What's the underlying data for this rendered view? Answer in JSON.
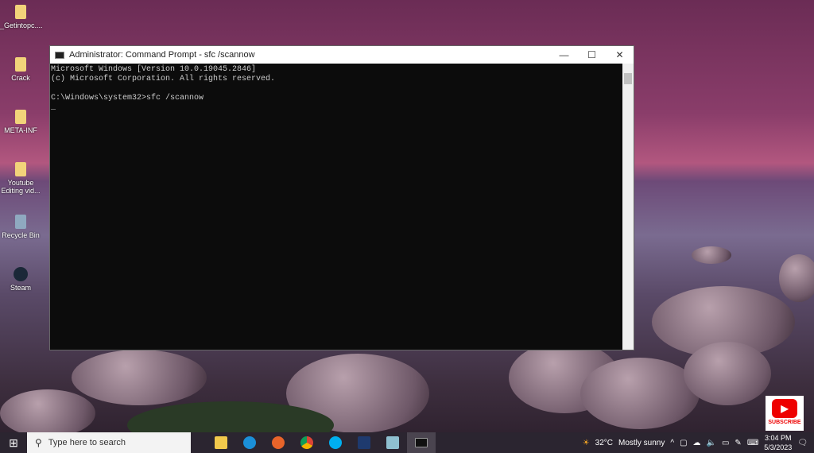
{
  "desktop": {
    "icons": [
      {
        "label": "_Getintopc....",
        "icon": "folder-icon"
      },
      {
        "label": "Crack",
        "icon": "folder-icon"
      },
      {
        "label": "META-INF",
        "icon": "folder-icon"
      },
      {
        "label": "Youtube Editing vid...",
        "icon": "folder-shortcut-icon"
      },
      {
        "label": "Recycle Bin",
        "icon": "recycle-bin-icon"
      },
      {
        "label": "Steam",
        "icon": "steam-icon"
      }
    ]
  },
  "window": {
    "title": "Administrator: Command Prompt - sfc  /scannow",
    "minimize": "—",
    "maximize": "☐",
    "close": "✕",
    "lines": [
      "Microsoft Windows [Version 10.0.19045.2846]",
      "(c) Microsoft Corporation. All rights reserved.",
      "",
      "C:\\Windows\\system32>sfc /scannow",
      "_"
    ]
  },
  "taskbar": {
    "start": "⊞",
    "search_placeholder": "Type here to search",
    "apps": [
      "file-explorer",
      "edge",
      "firefox",
      "chrome",
      "skype",
      "app",
      "app2",
      "command-prompt"
    ],
    "weather": {
      "temp": "32°C",
      "desc": "Mostly sunny"
    },
    "time": "3:04 PM",
    "date": "5/3/2023"
  },
  "overlay": {
    "subscribe": "SUBSCRIBE"
  }
}
